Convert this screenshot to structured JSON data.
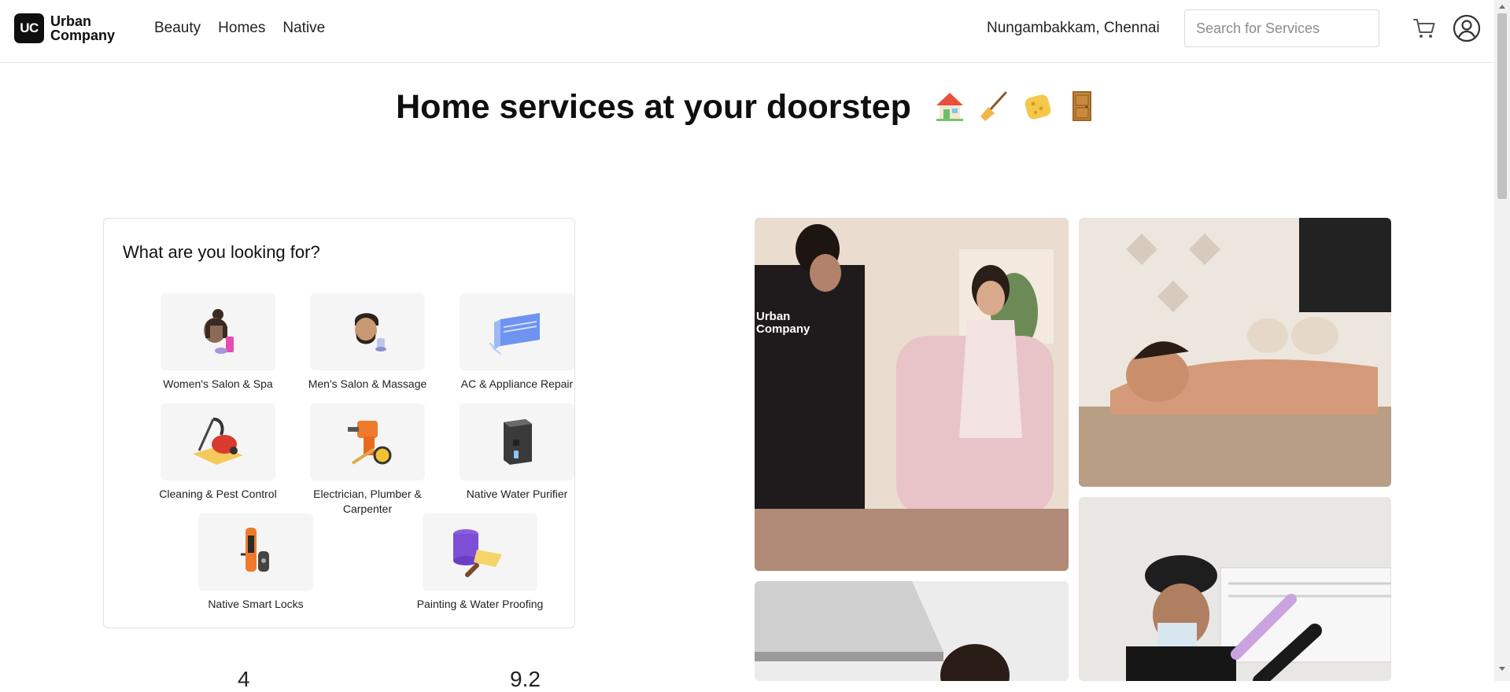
{
  "brand": {
    "logo_mark": "UC",
    "name_line1": "Urban",
    "name_line2": "Company"
  },
  "nav": {
    "items": [
      "Beauty",
      "Homes",
      "Native"
    ]
  },
  "header": {
    "location": "Nungambakkam, Chennai",
    "search_placeholder": "Search for Services",
    "icons": [
      "cart-icon",
      "profile-icon"
    ]
  },
  "hero": {
    "title": "Home services at your doorstep",
    "emoji_icons": [
      "house-icon",
      "broom-icon",
      "sponge-icon",
      "door-icon"
    ]
  },
  "services": {
    "heading": "What are you looking for?",
    "items": [
      {
        "label": "Women's Salon & Spa",
        "icon": "woman-facial-icon"
      },
      {
        "label": "Men's Salon & Massage",
        "icon": "man-grooming-icon"
      },
      {
        "label": "AC & Appliance Repair",
        "icon": "ac-unit-icon"
      },
      {
        "label": "Cleaning & Pest Control",
        "icon": "vacuum-cleaner-icon"
      },
      {
        "label": "Electrician, Plumber & Carpenter",
        "icon": "drill-tool-icon"
      },
      {
        "label": "Native Water Purifier",
        "icon": "water-purifier-icon"
      },
      {
        "label": "Native Smart Locks",
        "icon": "smart-lock-icon"
      },
      {
        "label": "Painting & Water Proofing",
        "icon": "paint-roller-icon"
      }
    ]
  },
  "photos": [
    {
      "name": "women-salon-photo",
      "overlay_text": "Urban Company"
    },
    {
      "name": "massage-photo"
    },
    {
      "name": "kitchen-cleaning-photo"
    },
    {
      "name": "ac-repair-photo"
    }
  ],
  "partial_below_fold": [
    "4",
    "9.2"
  ],
  "colors": {
    "brand": "#0f0f0f",
    "tile_bg": "#f5f5f5",
    "border": "#e2e2e2"
  }
}
